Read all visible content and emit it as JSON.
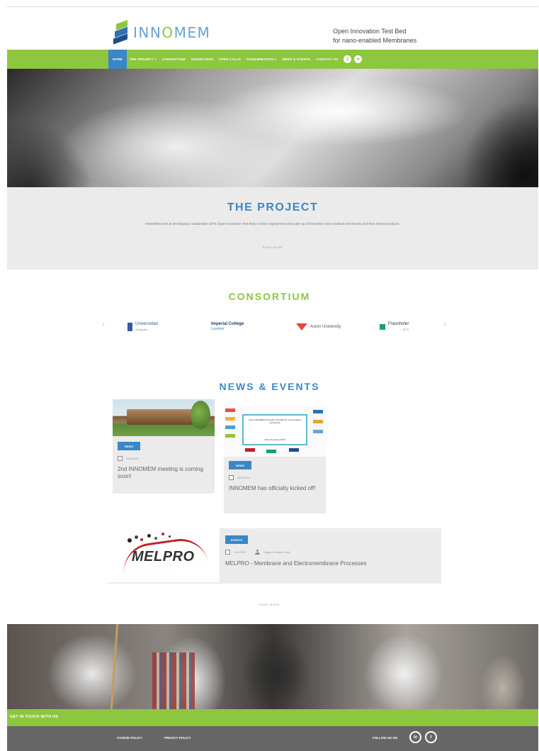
{
  "header": {
    "logo_parts": [
      "INN",
      "O",
      "MEM"
    ],
    "tagline_line1": "Open Innovation Test Bed",
    "tagline_line2": "for nano-enabled Membranes"
  },
  "nav": {
    "items": [
      {
        "label": "HOME",
        "active": true
      },
      {
        "label": "THE PROJECT ˅"
      },
      {
        "label": "CONSORTIUM"
      },
      {
        "label": "SHOWCASES"
      },
      {
        "label": "OPEN CALLS"
      },
      {
        "label": "DISSEMINATION ˅"
      },
      {
        "label": "NEWS & EVENTS"
      },
      {
        "label": "CONTACT US"
      }
    ],
    "icons": [
      "search-icon",
      "user-icon"
    ]
  },
  "project": {
    "title": "THE PROJECT",
    "text": "INNOMEM aims at developing a sustainable OITB (Open Innovation Test Bed) to foster deployment and scale-up of innovative nano-enabled membranes and their derived products.",
    "readmore": "READ MORE"
  },
  "consortium": {
    "title": "CONSORTIUM",
    "partners": [
      {
        "name": "Universidad",
        "sub": "Zaragoza"
      },
      {
        "name": "Imperial College",
        "sub": "London"
      },
      {
        "name": "Aston University",
        "sub": ""
      },
      {
        "name": "Fraunhofer",
        "sub": "IKTS"
      }
    ]
  },
  "news": {
    "title": "NEWS & EVENTS",
    "cards": [
      {
        "tag": "NEWS",
        "date": "28/05/2020",
        "headline": "2nd INNOMEM meeting is coming soon!"
      },
      {
        "tag": "NEWS",
        "date": "08/01/2020",
        "headline": "INNOMEM has officially kicked off!"
      },
      {
        "tag": "EVENTS",
        "date": "19/11/2019",
        "author": "Reggio di Calabria, Italy",
        "headline": "MELPRO - Membrane and Electromembrane Processes",
        "logo": "MELPRO"
      }
    ],
    "poster_text": "Open INNOMEM Innovation Test Bed for nano-enabled membranes",
    "poster_sub": "Kick-off meeting 2020",
    "readmore": "READ MORE"
  },
  "touch": {
    "label": "GET IN TOUCH WITH US"
  },
  "footer": {
    "links": [
      "COOKIE POLICY",
      "PRIVACY POLICY"
    ],
    "follow": "FOLLOW US ON",
    "social": [
      "in",
      "t"
    ]
  },
  "colors": {
    "green": "#8dc63f",
    "blue": "#3a87c8",
    "footer": "#666666",
    "section_bg": "#ebebeb"
  }
}
